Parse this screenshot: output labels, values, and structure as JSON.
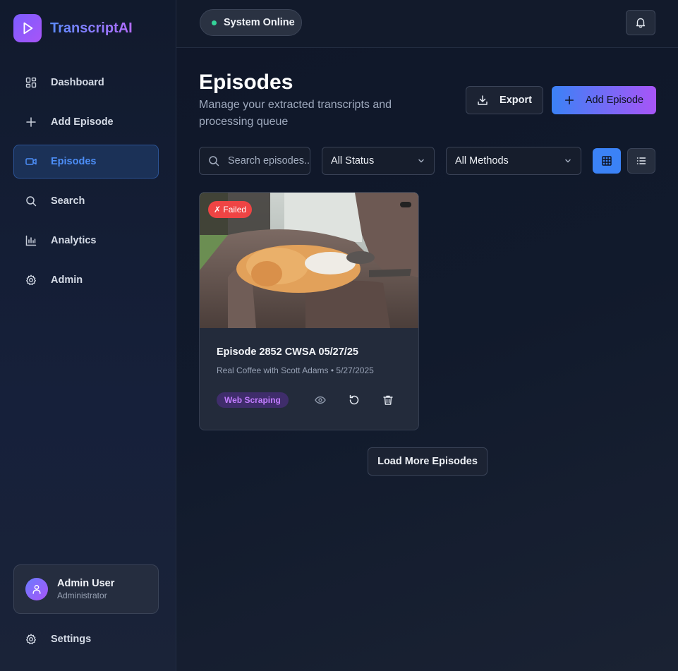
{
  "app": {
    "name": "TranscriptAI"
  },
  "sidebar": {
    "items": [
      {
        "label": "Dashboard",
        "icon": "dashboard-icon"
      },
      {
        "label": "Add Episode",
        "icon": "plus-icon"
      },
      {
        "label": "Episodes",
        "icon": "video-icon",
        "active": true
      },
      {
        "label": "Search",
        "icon": "search-icon"
      },
      {
        "label": "Analytics",
        "icon": "bar-chart-icon"
      },
      {
        "label": "Admin",
        "icon": "gear-icon"
      }
    ],
    "user": {
      "name": "Admin User",
      "role": "Administrator"
    },
    "settings_label": "Settings"
  },
  "topbar": {
    "status_text": "System Online",
    "status_color": "#34d399"
  },
  "page": {
    "title": "Episodes",
    "subtitle": "Manage your extracted transcripts and processing queue",
    "export_label": "Export",
    "add_label": "Add Episode"
  },
  "filters": {
    "search_placeholder": "Search episodes...",
    "status_selected": "All Status",
    "method_selected": "All Methods",
    "view_mode": "grid"
  },
  "episodes": [
    {
      "title": "Episode 2852 CWSA 05/27/25",
      "show": "Real Coffee with Scott Adams",
      "date": "5/27/2025",
      "status": "✗ Failed",
      "method": "Web Scraping"
    }
  ],
  "load_more_label": "Load More Episodes",
  "colors": {
    "accent_blue": "#3b82f6",
    "accent_purple": "#a855f7",
    "failed_red": "#ef4444"
  }
}
